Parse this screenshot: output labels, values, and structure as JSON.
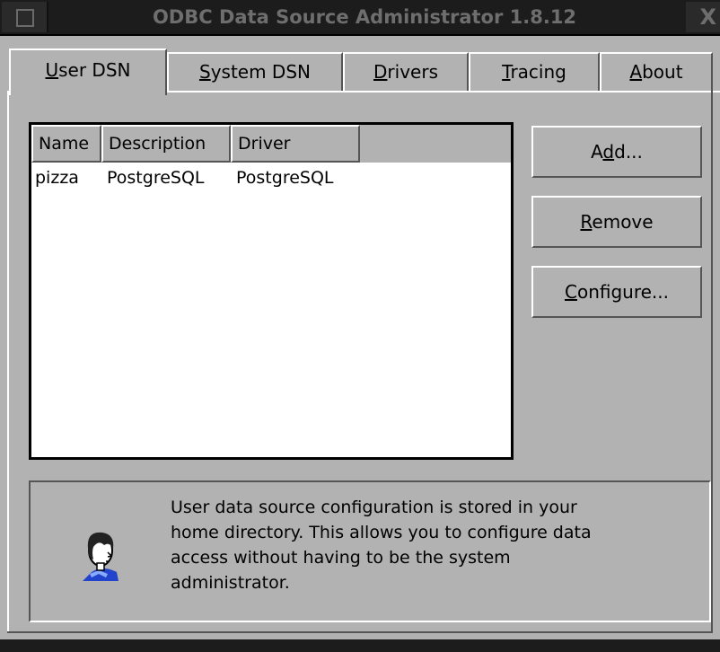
{
  "window": {
    "title": "ODBC Data Source Administrator 1.8.12",
    "close_label": "X"
  },
  "tabs": [
    {
      "label": "User DSN",
      "mnemonic": "U",
      "rest": "ser DSN",
      "active": true
    },
    {
      "label": "System DSN",
      "mnemonic": "S",
      "rest": "ystem DSN",
      "active": false
    },
    {
      "label": "Drivers",
      "mnemonic": "D",
      "rest": "rivers",
      "active": false
    },
    {
      "label": "Tracing",
      "mnemonic": "T",
      "rest": "racing",
      "active": false
    },
    {
      "label": "About",
      "mnemonic": "A",
      "rest": "bout",
      "active": false
    }
  ],
  "list": {
    "columns": [
      "Name",
      "Description",
      "Driver"
    ],
    "rows": [
      {
        "name": "pizza",
        "description": "PostgreSQL",
        "driver": "PostgreSQL"
      }
    ]
  },
  "buttons": {
    "add": {
      "pre": "A",
      "mnemonic": "d",
      "post": "d..."
    },
    "remove": {
      "pre": "",
      "mnemonic": "R",
      "post": "emove"
    },
    "configure": {
      "pre": "",
      "mnemonic": "C",
      "post": "onfigure..."
    }
  },
  "info": {
    "lines": [
      "User data source configuration is stored in your",
      "home directory. This allows you to configure data",
      "access without having to be the system",
      "administrator."
    ],
    "icon": "user-person-icon"
  },
  "colors": {
    "background": "#b2b2b2",
    "titlebar": "#1c1c1c",
    "title_text": "#6e6e6e"
  }
}
